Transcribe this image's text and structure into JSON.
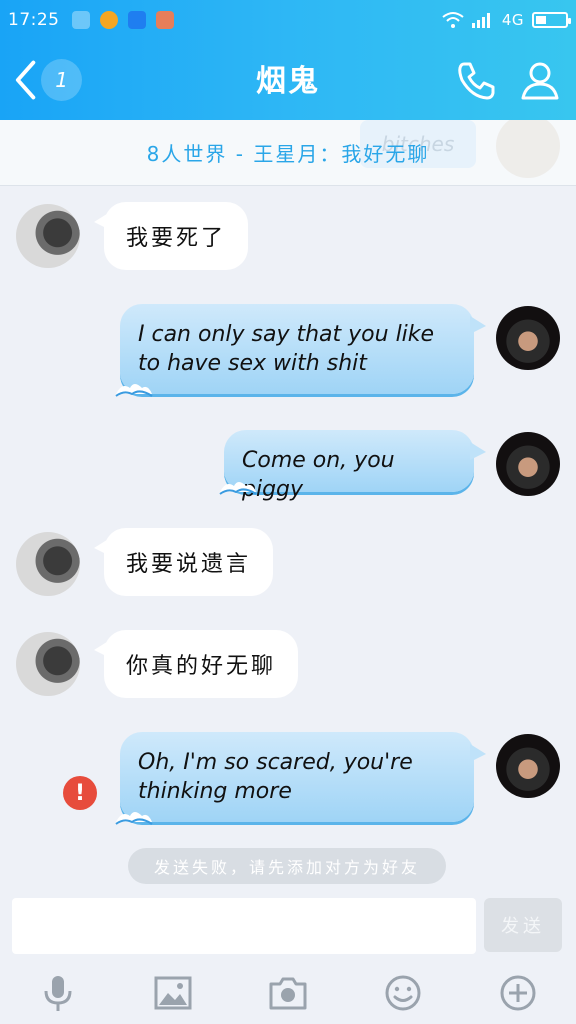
{
  "status_bar": {
    "time": "17:25",
    "network": "4G"
  },
  "nav": {
    "title": "烟鬼",
    "unread_count": "1"
  },
  "notice": {
    "text": "8人世界 - 王星月：我好无聊",
    "ghost_text": "bitches"
  },
  "messages": [
    {
      "side": "in",
      "text": "我要死了"
    },
    {
      "side": "out",
      "line1": "I can only say that you like",
      "line2": "to have sex with shit"
    },
    {
      "side": "out",
      "line1": "Come on, you piggy"
    },
    {
      "side": "in",
      "text": "我要说遗言"
    },
    {
      "side": "in",
      "text": "你真的好无聊"
    },
    {
      "side": "out",
      "line1": "Oh, I'm so scared, you're",
      "line2": "thinking more",
      "failed": true
    }
  ],
  "system_tip": "发送失败，请先添加对方为好友",
  "input": {
    "value": "",
    "send_label": "发送"
  },
  "icons": {
    "back": "chevron-left-icon",
    "call": "phone-icon",
    "profile": "user-icon",
    "error": "exclamation-icon",
    "toolbar": [
      "microphone-icon",
      "image-icon",
      "camera-icon",
      "emoji-icon",
      "plus-icon"
    ]
  },
  "colors": {
    "header_start": "#19a4f6",
    "header_end": "#38c6ef",
    "accent_text": "#2aa6e8",
    "out_bubble": "#a9daf7",
    "error": "#e74c3c"
  }
}
